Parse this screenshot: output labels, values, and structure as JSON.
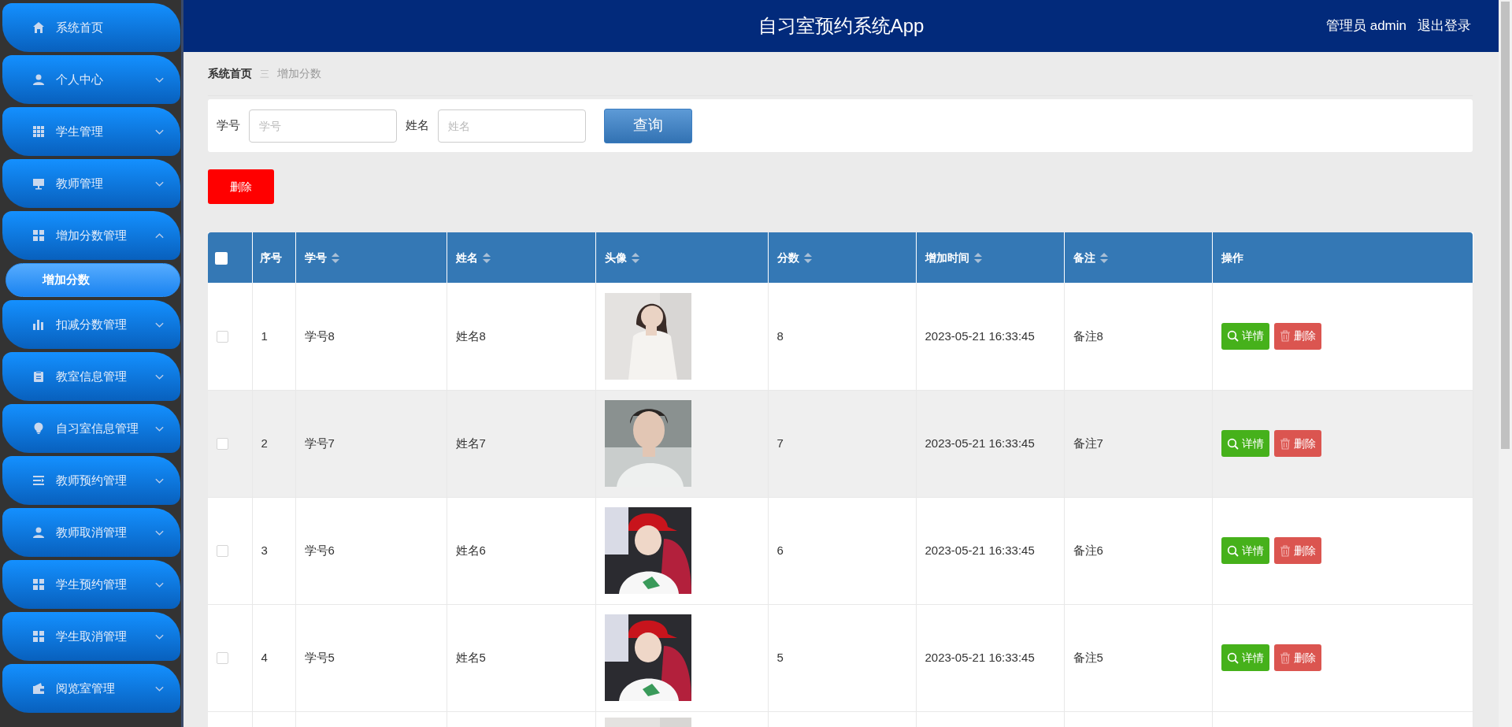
{
  "header": {
    "title": "自习室预约系统App",
    "user": "管理员 admin",
    "logout": "退出登录"
  },
  "sidebar": {
    "items": [
      {
        "label": "系统首页"
      },
      {
        "label": "个人中心",
        "expanded": false
      },
      {
        "label": "学生管理",
        "expanded": false
      },
      {
        "label": "教师管理",
        "expanded": false
      },
      {
        "label": "增加分数管理",
        "expanded": true,
        "children": [
          {
            "label": "增加分数",
            "selected": true
          }
        ]
      },
      {
        "label": "扣减分数管理",
        "expanded": false
      },
      {
        "label": "教室信息管理",
        "expanded": false
      },
      {
        "label": "自习室信息管理",
        "expanded": false
      },
      {
        "label": "教师预约管理",
        "expanded": false
      },
      {
        "label": "教师取消管理",
        "expanded": false
      },
      {
        "label": "学生预约管理",
        "expanded": false
      },
      {
        "label": "学生取消管理",
        "expanded": false
      },
      {
        "label": "阅览室管理",
        "expanded": false
      }
    ]
  },
  "breadcrumb": {
    "home": "系统首页",
    "separator": "三",
    "current": "增加分数"
  },
  "search": {
    "fields": [
      {
        "label": "学号",
        "placeholder": "学号"
      },
      {
        "label": "姓名",
        "placeholder": "姓名"
      }
    ],
    "button": "查询"
  },
  "delete_button": "删除",
  "table": {
    "select_all": {
      "checked": false
    },
    "columns": [
      {
        "label": "序号",
        "sortable": false
      },
      {
        "label": "学号",
        "sortable": true
      },
      {
        "label": "姓名",
        "sortable": true
      },
      {
        "label": "头像",
        "sortable": true
      },
      {
        "label": "分数",
        "sortable": true
      },
      {
        "label": "增加时间",
        "sortable": true
      },
      {
        "label": "备注",
        "sortable": true
      },
      {
        "label": "操作",
        "sortable": false
      }
    ],
    "rows": [
      {
        "checked": false,
        "highlighted": false,
        "index": "1",
        "student_id": "学号8",
        "name": "姓名8",
        "avatar": {
          "kind": "picture"
        },
        "score": "8",
        "time": "2023-05-21 16:33:45",
        "note": "备注8",
        "actions": [
          "详情",
          "删除"
        ]
      },
      {
        "checked": false,
        "highlighted": true,
        "index": "2",
        "student_id": "学号7",
        "name": "姓名7",
        "avatar": {
          "kind": "picture"
        },
        "score": "7",
        "time": "2023-05-21 16:33:45",
        "note": "备注7",
        "actions": [
          "详情",
          "删除"
        ]
      },
      {
        "checked": false,
        "highlighted": false,
        "index": "3",
        "student_id": "学号6",
        "name": "姓名6",
        "avatar": {
          "kind": "picture"
        },
        "score": "6",
        "time": "2023-05-21 16:33:45",
        "note": "备注6",
        "actions": [
          "详情",
          "删除"
        ]
      },
      {
        "checked": false,
        "highlighted": false,
        "index": "4",
        "student_id": "学号5",
        "name": "姓名5",
        "avatar": {
          "kind": "picture"
        },
        "score": "5",
        "time": "2023-05-21 16:33:45",
        "note": "备注5",
        "actions": [
          "详情",
          "删除"
        ]
      },
      {
        "avatar": {
          "kind": "picture"
        }
      }
    ]
  }
}
